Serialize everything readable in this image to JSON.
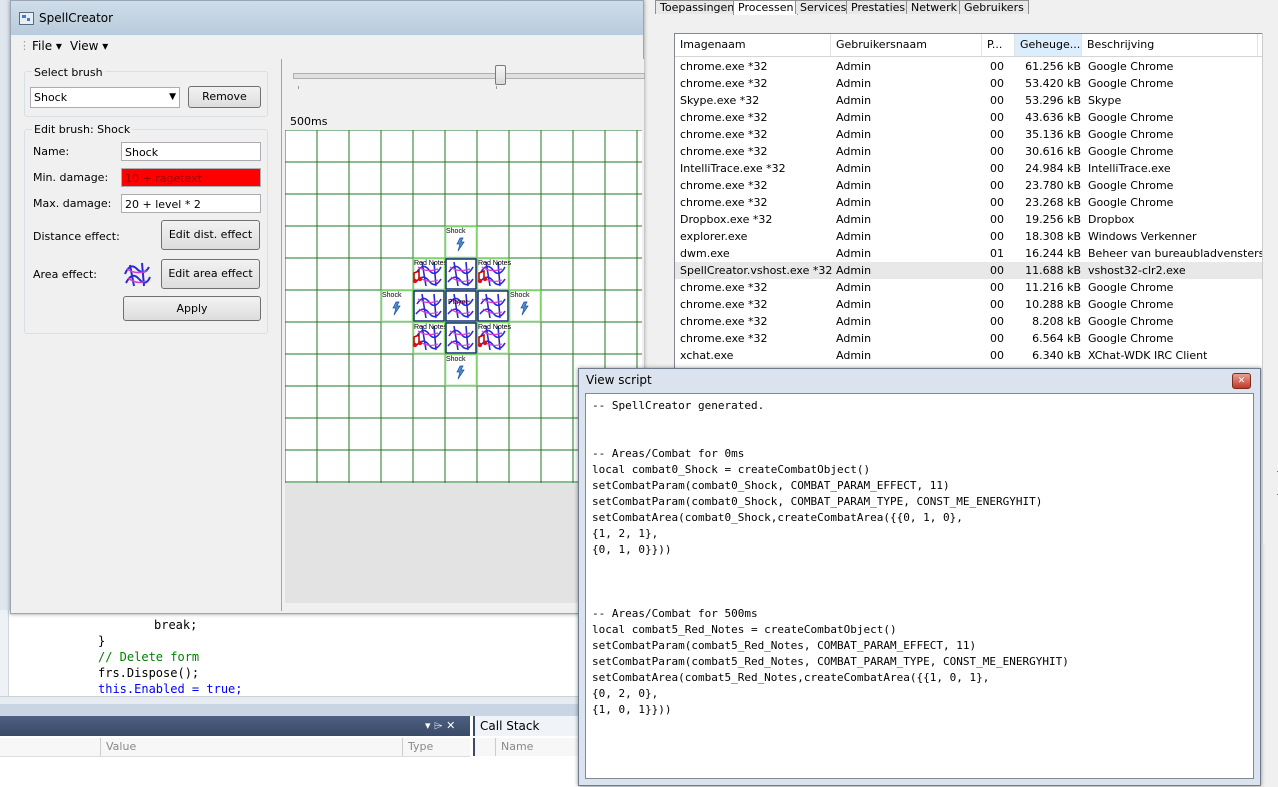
{
  "task_manager": {
    "tabs": [
      "Toepassingen",
      "Processen",
      "Services",
      "Prestaties",
      "Netwerk",
      "Gebruikers"
    ],
    "active_tab": "Processen",
    "columns": [
      "Imagenaam",
      "Gebruikersnaam",
      "P...",
      "Geheuge...",
      "Beschrijving"
    ],
    "rows": [
      {
        "name": "chrome.exe *32",
        "user": "Admin",
        "p": "00",
        "mem": "61.256 kB",
        "desc": "Google Chrome"
      },
      {
        "name": "chrome.exe *32",
        "user": "Admin",
        "p": "00",
        "mem": "53.420 kB",
        "desc": "Google Chrome"
      },
      {
        "name": "Skype.exe *32",
        "user": "Admin",
        "p": "00",
        "mem": "53.296 kB",
        "desc": "Skype"
      },
      {
        "name": "chrome.exe *32",
        "user": "Admin",
        "p": "00",
        "mem": "43.636 kB",
        "desc": "Google Chrome"
      },
      {
        "name": "chrome.exe *32",
        "user": "Admin",
        "p": "00",
        "mem": "35.136 kB",
        "desc": "Google Chrome"
      },
      {
        "name": "chrome.exe *32",
        "user": "Admin",
        "p": "00",
        "mem": "30.616 kB",
        "desc": "Google Chrome"
      },
      {
        "name": "IntelliTrace.exe *32",
        "user": "Admin",
        "p": "00",
        "mem": "24.984 kB",
        "desc": "IntelliTrace.exe"
      },
      {
        "name": "chrome.exe *32",
        "user": "Admin",
        "p": "00",
        "mem": "23.780 kB",
        "desc": "Google Chrome"
      },
      {
        "name": "chrome.exe *32",
        "user": "Admin",
        "p": "00",
        "mem": "23.268 kB",
        "desc": "Google Chrome"
      },
      {
        "name": "Dropbox.exe *32",
        "user": "Admin",
        "p": "00",
        "mem": "19.256 kB",
        "desc": "Dropbox"
      },
      {
        "name": "explorer.exe",
        "user": "Admin",
        "p": "00",
        "mem": "18.308 kB",
        "desc": "Windows Verkenner"
      },
      {
        "name": "dwm.exe",
        "user": "Admin",
        "p": "01",
        "mem": "16.244 kB",
        "desc": "Beheer van bureaubladvensters"
      },
      {
        "name": "SpellCreator.vshost.exe *32",
        "user": "Admin",
        "p": "00",
        "mem": "11.688 kB",
        "desc": "vshost32-clr2.exe"
      },
      {
        "name": "chrome.exe *32",
        "user": "Admin",
        "p": "00",
        "mem": "11.216 kB",
        "desc": "Google Chrome"
      },
      {
        "name": "chrome.exe *32",
        "user": "Admin",
        "p": "00",
        "mem": "10.288 kB",
        "desc": "Google Chrome"
      },
      {
        "name": "chrome.exe *32",
        "user": "Admin",
        "p": "00",
        "mem": "8.208 kB",
        "desc": "Google Chrome"
      },
      {
        "name": "chrome.exe *32",
        "user": "Admin",
        "p": "00",
        "mem": "6.564 kB",
        "desc": "Google Chrome"
      },
      {
        "name": "xchat.exe",
        "user": "Admin",
        "p": "00",
        "mem": "6.340 kB",
        "desc": "XChat-WDK IRC Client"
      }
    ],
    "selected_row": 12
  },
  "visual_studio": {
    "code_lines": [
      "break;",
      "}",
      "// Delete form",
      "frs.Dispose();",
      "this.Enabled = true;"
    ],
    "locals_columns": [
      "Value",
      "Type"
    ],
    "call_stack_title": "Call Stack",
    "call_stack_column": "Name",
    "pin_glyphs": "▾ ⌲ ✕"
  },
  "spell_creator": {
    "title": "SpellCreator",
    "menu": {
      "file": "File ▾",
      "view": "View ▾"
    },
    "select_brush": {
      "group_label": "Select brush",
      "selected": "Shock",
      "remove_label": "Remove"
    },
    "edit_brush": {
      "group_label": "Edit brush: Shock",
      "name_label": "Name:",
      "name_value": "Shock",
      "min_label": "Min. damage:",
      "min_value": "10 + ragetext",
      "max_label": "Max. damage:",
      "max_value": "20 + level * 2",
      "dist_label": "Distance effect:",
      "dist_button": "Edit dist. effect",
      "area_label": "Area effect:",
      "area_button": "Edit area effect",
      "apply_label": "Apply"
    },
    "slider": {
      "value_fraction": 0.59
    },
    "time_label": "500ms",
    "grid": {
      "cells": [
        {
          "col": 5,
          "row": 3,
          "label": "Shock",
          "kind": "shock"
        },
        {
          "col": 4,
          "row": 4,
          "label": "Red Notes",
          "kind": "note"
        },
        {
          "col": 6,
          "row": 4,
          "label": "Red Notes",
          "kind": "note"
        },
        {
          "col": 5,
          "row": 4,
          "label": "",
          "kind": "energy"
        },
        {
          "col": 3,
          "row": 5,
          "label": "Shock",
          "kind": "shock"
        },
        {
          "col": 4,
          "row": 5,
          "label": "",
          "kind": "energy"
        },
        {
          "col": 5,
          "row": 5,
          "label": "Player",
          "kind": "player"
        },
        {
          "col": 6,
          "row": 5,
          "label": "",
          "kind": "energy"
        },
        {
          "col": 7,
          "row": 5,
          "label": "Shock",
          "kind": "shock"
        },
        {
          "col": 4,
          "row": 6,
          "label": "Red Notes",
          "kind": "note"
        },
        {
          "col": 6,
          "row": 6,
          "label": "Red Notes",
          "kind": "note"
        },
        {
          "col": 5,
          "row": 6,
          "label": "",
          "kind": "energy"
        },
        {
          "col": 5,
          "row": 7,
          "label": "Shock",
          "kind": "shock"
        }
      ]
    }
  },
  "view_script": {
    "title": "View script",
    "close_glyph": "✕",
    "lines": [
      "-- SpellCreator generated.",
      "",
      "",
      "-- Areas/Combat for 0ms",
      "local combat0_Shock = createCombatObject()",
      "setCombatParam(combat0_Shock, COMBAT_PARAM_EFFECT, 11)",
      "setCombatParam(combat0_Shock, COMBAT_PARAM_TYPE, CONST_ME_ENERGYHIT)",
      "setCombatArea(combat0_Shock,createCombatArea({{0, 1, 0},",
      "{1, 2, 1},",
      "{0, 1, 0}}))",
      "",
      "",
      "",
      "-- Areas/Combat for 500ms",
      "local combat5_Red_Notes = createCombatObject()",
      "setCombatParam(combat5_Red_Notes, COMBAT_PARAM_EFFECT, 11)",
      "setCombatParam(combat5_Red_Notes, COMBAT_PARAM_TYPE, CONST_ME_ENERGYHIT)",
      "setCombatArea(combat5_Red_Notes,createCombatArea({{1, 0, 1},",
      "{0, 2, 0},",
      "{1, 0, 1}}))"
    ]
  },
  "colors": {
    "error_field": "#ff0000",
    "grid_line": "#1f7a1f",
    "area_border": "#7fd36a",
    "dialog_border": "#6d7d8f"
  },
  "icons": [
    "app-icon",
    "dropdown-arrow-icon",
    "close-icon",
    "shock-icon",
    "red-note-icon",
    "energy-icon"
  ]
}
